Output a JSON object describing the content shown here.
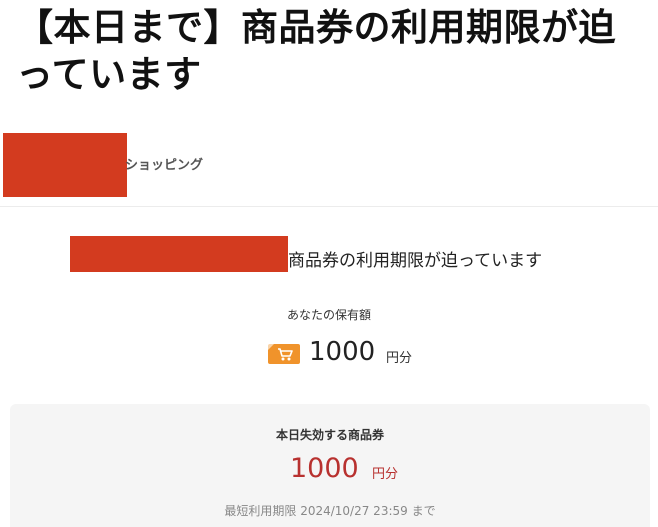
{
  "headline": "【本日まで】商品券の利用期限が迫っています",
  "brand": {
    "suffix": "ショッピング"
  },
  "notice": {
    "text": "商品券の利用期限が迫っています"
  },
  "holding": {
    "label": "あなたの保有額",
    "amount": "1000",
    "unit": "円分",
    "icon": "shopping-cart-coupon-icon"
  },
  "expiring": {
    "title": "本日失効する商品券",
    "amount": "1000",
    "unit": "円分",
    "deadline": "最短利用期限 2024/10/27 23:59 まで"
  },
  "colors": {
    "redaction": "#d33b1f",
    "accent_red": "#b8312f",
    "coupon_orange": "#f0932b",
    "box_bg": "#f5f5f5"
  }
}
